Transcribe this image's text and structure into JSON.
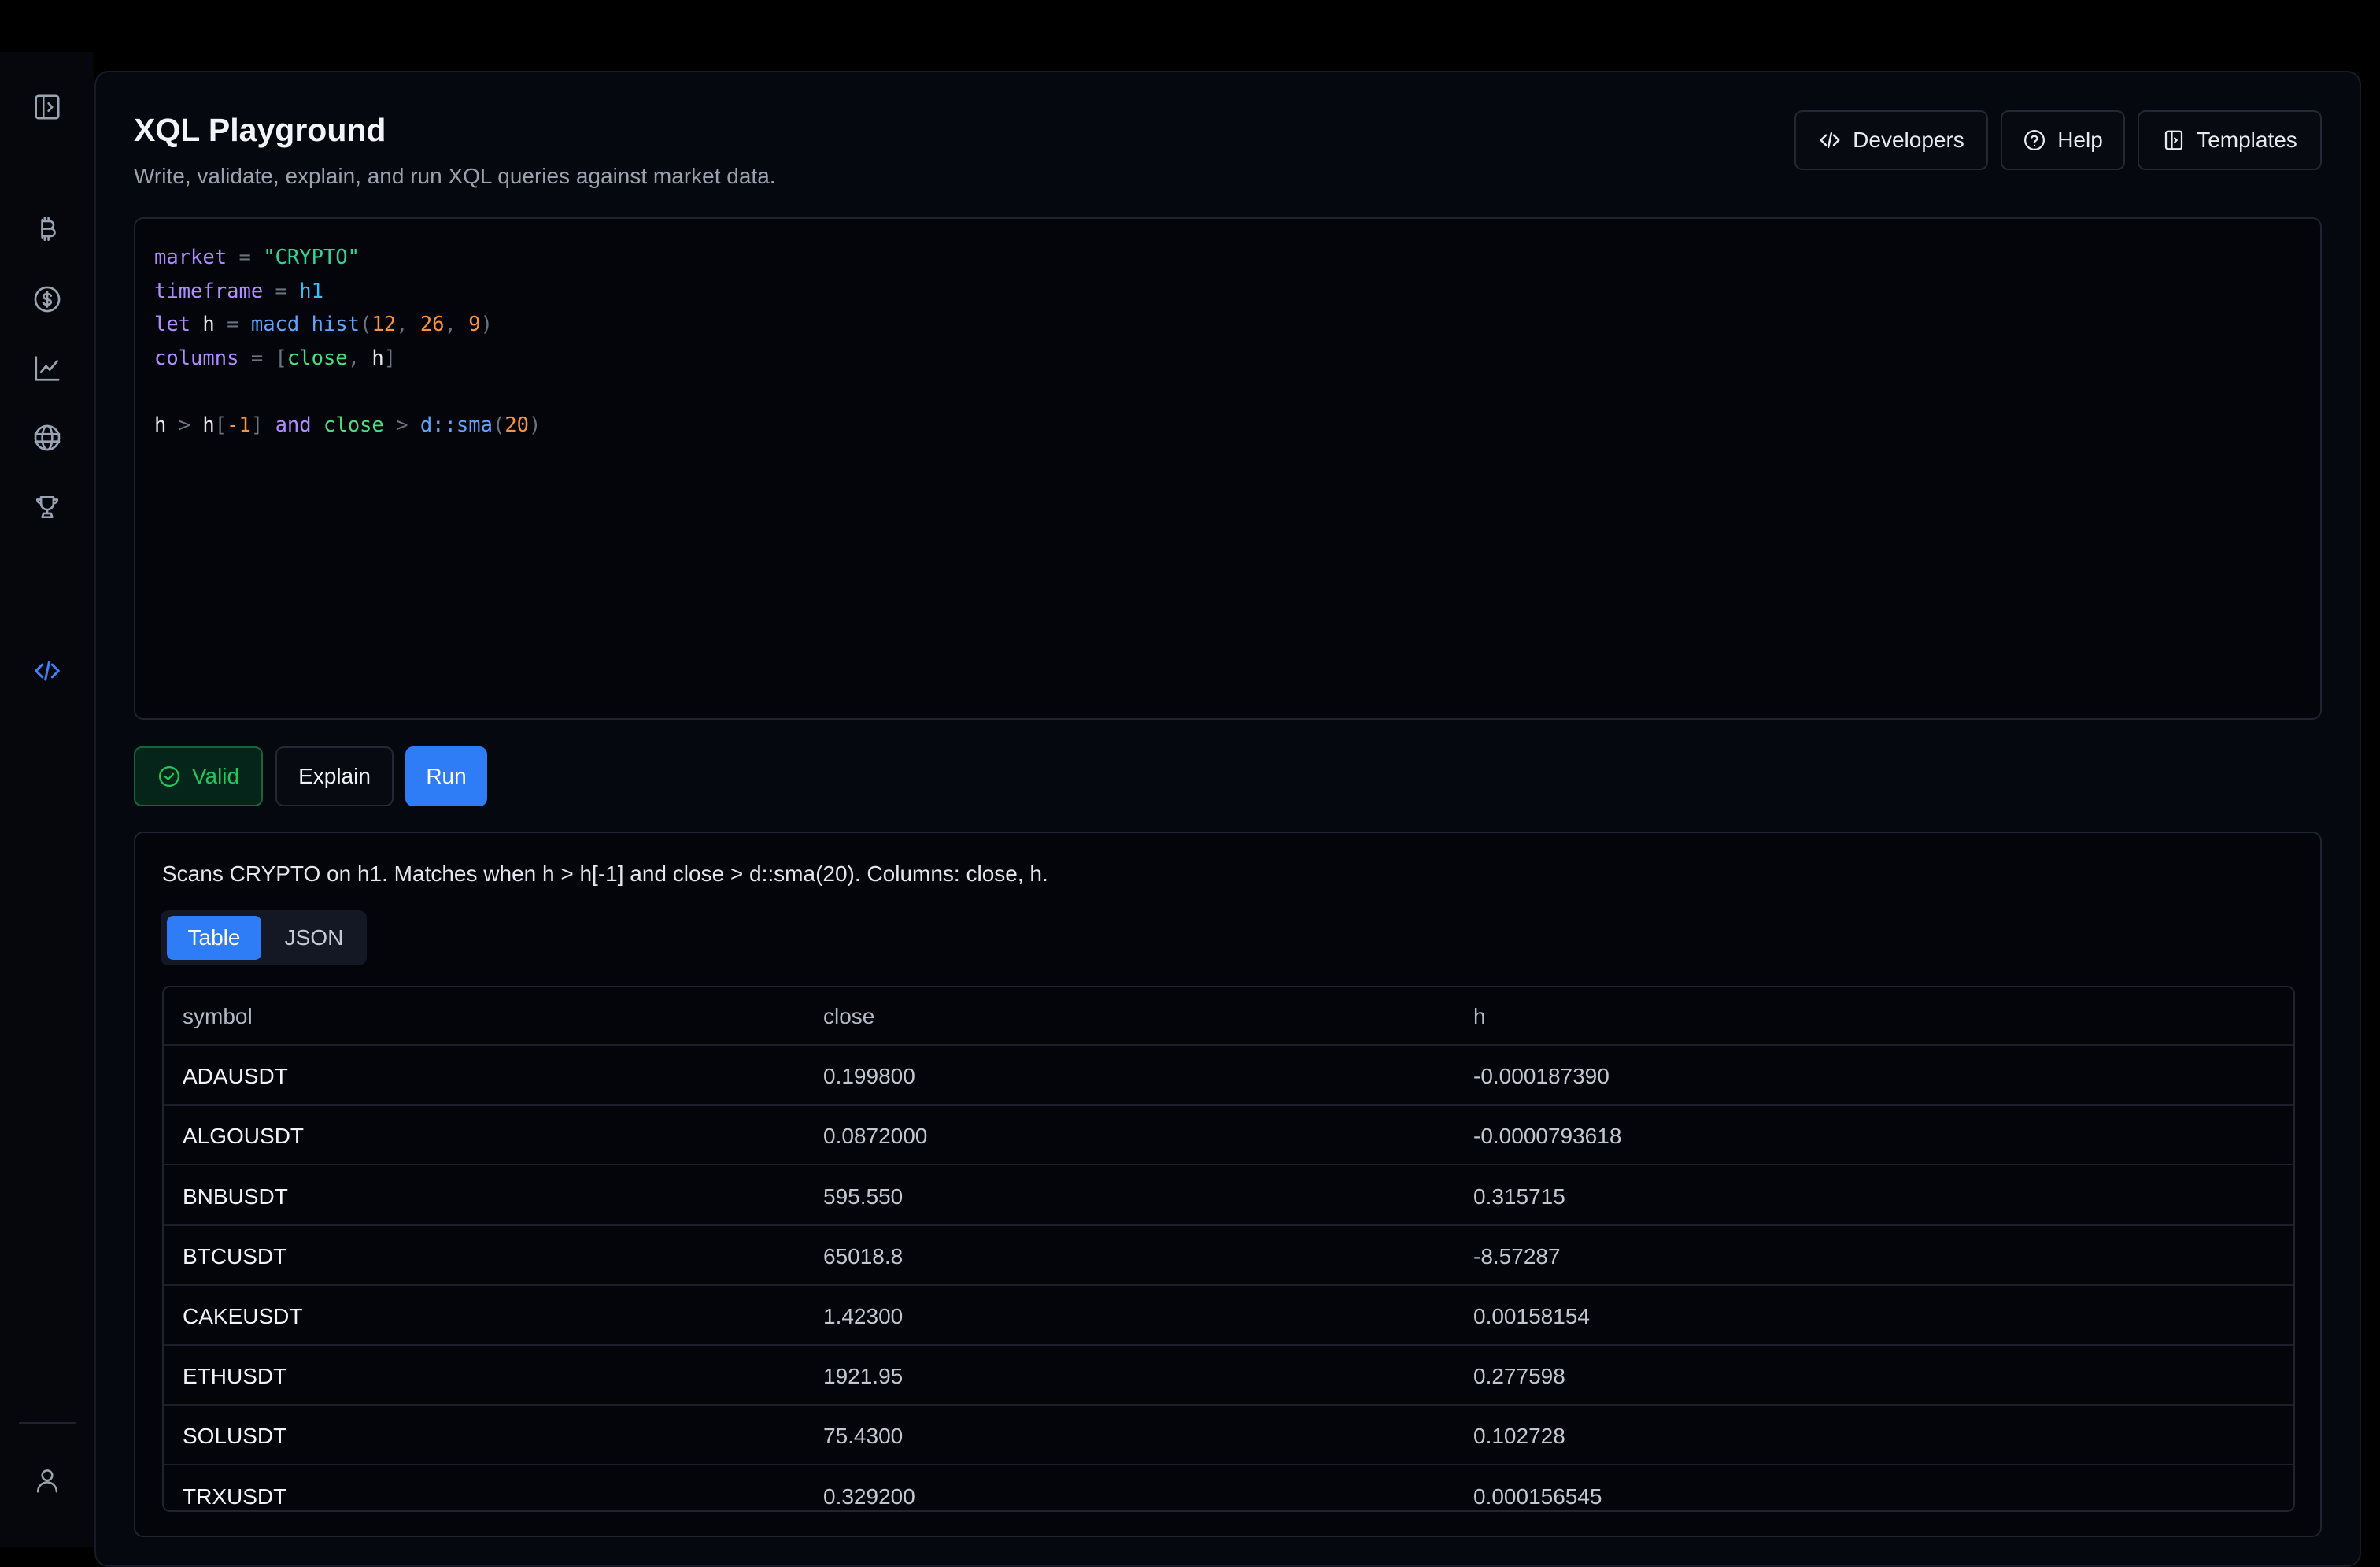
{
  "header": {
    "title": "XQL Playground",
    "subtitle": "Write, validate, explain, and run XQL queries against market data.",
    "buttons": {
      "developers": "Developers",
      "help": "Help",
      "templates": "Templates"
    }
  },
  "sidebar": {
    "items": [
      {
        "icon": "panel-toggle-icon"
      },
      {
        "icon": "bitcoin-icon"
      },
      {
        "icon": "dollar-icon"
      },
      {
        "icon": "chart-line-icon"
      },
      {
        "icon": "globe-icon"
      },
      {
        "icon": "trophy-icon"
      },
      {
        "icon": "code-icon",
        "active": true
      },
      {
        "icon": "user-icon"
      }
    ]
  },
  "editor": {
    "lines": [
      [
        {
          "t": "market",
          "c": "k"
        },
        {
          "t": " = ",
          "c": "p"
        },
        {
          "t": "\"CRYPTO\"",
          "c": "s"
        }
      ],
      [
        {
          "t": "timeframe",
          "c": "k"
        },
        {
          "t": " = ",
          "c": "p"
        },
        {
          "t": "h1",
          "c": "t"
        }
      ],
      [
        {
          "t": "let",
          "c": "k"
        },
        {
          "t": " h ",
          "c": "w"
        },
        {
          "t": "= ",
          "c": "p"
        },
        {
          "t": "macd_hist",
          "c": "f"
        },
        {
          "t": "(",
          "c": "p"
        },
        {
          "t": "12",
          "c": "n"
        },
        {
          "t": ", ",
          "c": "p"
        },
        {
          "t": "26",
          "c": "n"
        },
        {
          "t": ", ",
          "c": "p"
        },
        {
          "t": "9",
          "c": "n"
        },
        {
          "t": ")",
          "c": "p"
        }
      ],
      [
        {
          "t": "columns",
          "c": "k"
        },
        {
          "t": " = [",
          "c": "p"
        },
        {
          "t": "close",
          "c": "c"
        },
        {
          "t": ", ",
          "c": "p"
        },
        {
          "t": "h",
          "c": "w"
        },
        {
          "t": "]",
          "c": "p"
        }
      ],
      [],
      [
        {
          "t": "h",
          "c": "w"
        },
        {
          "t": " > ",
          "c": "p"
        },
        {
          "t": "h",
          "c": "w"
        },
        {
          "t": "[",
          "c": "p"
        },
        {
          "t": "-1",
          "c": "n"
        },
        {
          "t": "] ",
          "c": "p"
        },
        {
          "t": "and",
          "c": "k"
        },
        {
          "t": " close",
          "c": "c"
        },
        {
          "t": " > ",
          "c": "p"
        },
        {
          "t": "d::sma",
          "c": "f"
        },
        {
          "t": "(",
          "c": "p"
        },
        {
          "t": "20",
          "c": "n"
        },
        {
          "t": ")",
          "c": "p"
        }
      ]
    ]
  },
  "actions": {
    "valid": "Valid",
    "explain": "Explain",
    "run": "Run"
  },
  "results": {
    "summary": "Scans CRYPTO on h1. Matches when h > h[-1] and close > d::sma(20). Columns: close, h.",
    "tabs": {
      "table": "Table",
      "json": "JSON"
    },
    "columns": [
      "symbol",
      "close",
      "h"
    ],
    "rows": [
      [
        "ADAUSDT",
        "0.199800",
        "-0.000187390"
      ],
      [
        "ALGOUSDT",
        "0.0872000",
        "-0.0000793618"
      ],
      [
        "BNBUSDT",
        "595.550",
        "0.315715"
      ],
      [
        "BTCUSDT",
        "65018.8",
        "-8.57287"
      ],
      [
        "CAKEUSDT",
        "1.42300",
        "0.00158154"
      ],
      [
        "ETHUSDT",
        "1921.95",
        "0.277598"
      ],
      [
        "SOLUSDT",
        "75.4300",
        "0.102728"
      ],
      [
        "TRXUSDT",
        "0.329200",
        "0.000156545"
      ]
    ]
  },
  "colors": {
    "accent": "#2f7df6",
    "valid": "#22c55e",
    "background": "#05080f"
  }
}
